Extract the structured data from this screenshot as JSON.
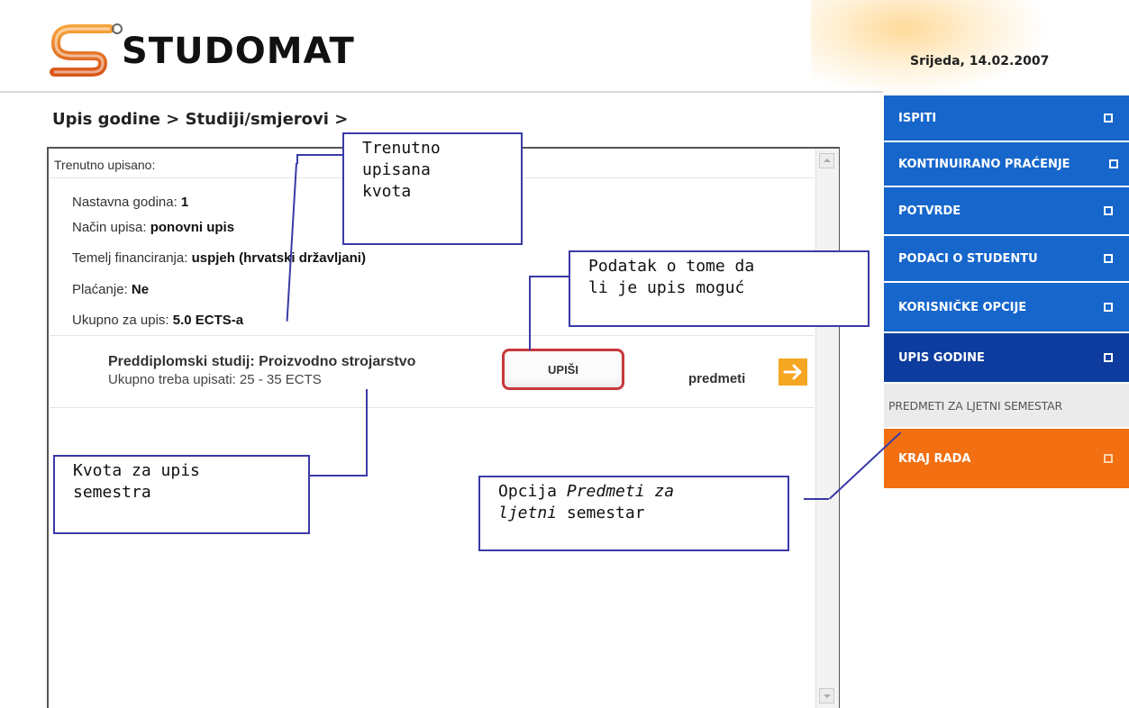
{
  "header": {
    "brand": "STUDOMAT",
    "date": "Srijeda, 14.02.2007"
  },
  "breadcrumb": "Upis godine > Studiji/smjerovi >",
  "current": {
    "heading": "Trenutno upisano:",
    "fields": [
      {
        "label": "Nastavna godina: ",
        "value": "1"
      },
      {
        "label": "Način upisa: ",
        "value": "ponovni upis"
      },
      {
        "label": "Temelj financiranja: ",
        "value": "uspjeh (hrvatski državljani)"
      },
      {
        "label": "Plaćanje: ",
        "value": "Ne"
      },
      {
        "label": "Ukupno za upis: ",
        "value": "5.0 ECTS-a"
      }
    ]
  },
  "program": {
    "title": "Preddiplomski studij: Proizvodno strojarstvo",
    "subtitle": "Ukupno treba upisati: 25 - 35 ECTS",
    "enroll_button": "UPIŠI",
    "subjects_label": "predmeti",
    "subjects_icon": "arrow-right-icon"
  },
  "sidebar": {
    "items": [
      {
        "label": "ISPITI"
      },
      {
        "label": "KONTINUIRANO PRAĆENJE"
      },
      {
        "label": "POTVRDE"
      },
      {
        "label": "PODACI O STUDENTU"
      },
      {
        "label": "KORISNIČKE OPCIJE"
      },
      {
        "label": "UPIS GODINE"
      },
      {
        "label": "PREDMETI ZA LJETNI SEMESTAR"
      },
      {
        "label": "KRAJ RADA"
      }
    ]
  },
  "annotations": {
    "quota_current": [
      "Trenutno",
      "upisana",
      "kvota"
    ],
    "enroll_possible": [
      "Podatak o tome da",
      "li je upis moguć"
    ],
    "semester_quota": [
      "Kvota za upis",
      "semestra"
    ],
    "option_prefix": "Opcija ",
    "option_em1": "Predmeti za",
    "option_em2": "ljetni",
    "option_suffix": " semestar"
  },
  "colors": {
    "menu_blue": "#1666cc",
    "menu_active": "#0d3c9e",
    "menu_exit": "#f26f12",
    "button_border": "#c8383b",
    "annotation": "#3a3aa8",
    "arrow": "#f5a623"
  }
}
